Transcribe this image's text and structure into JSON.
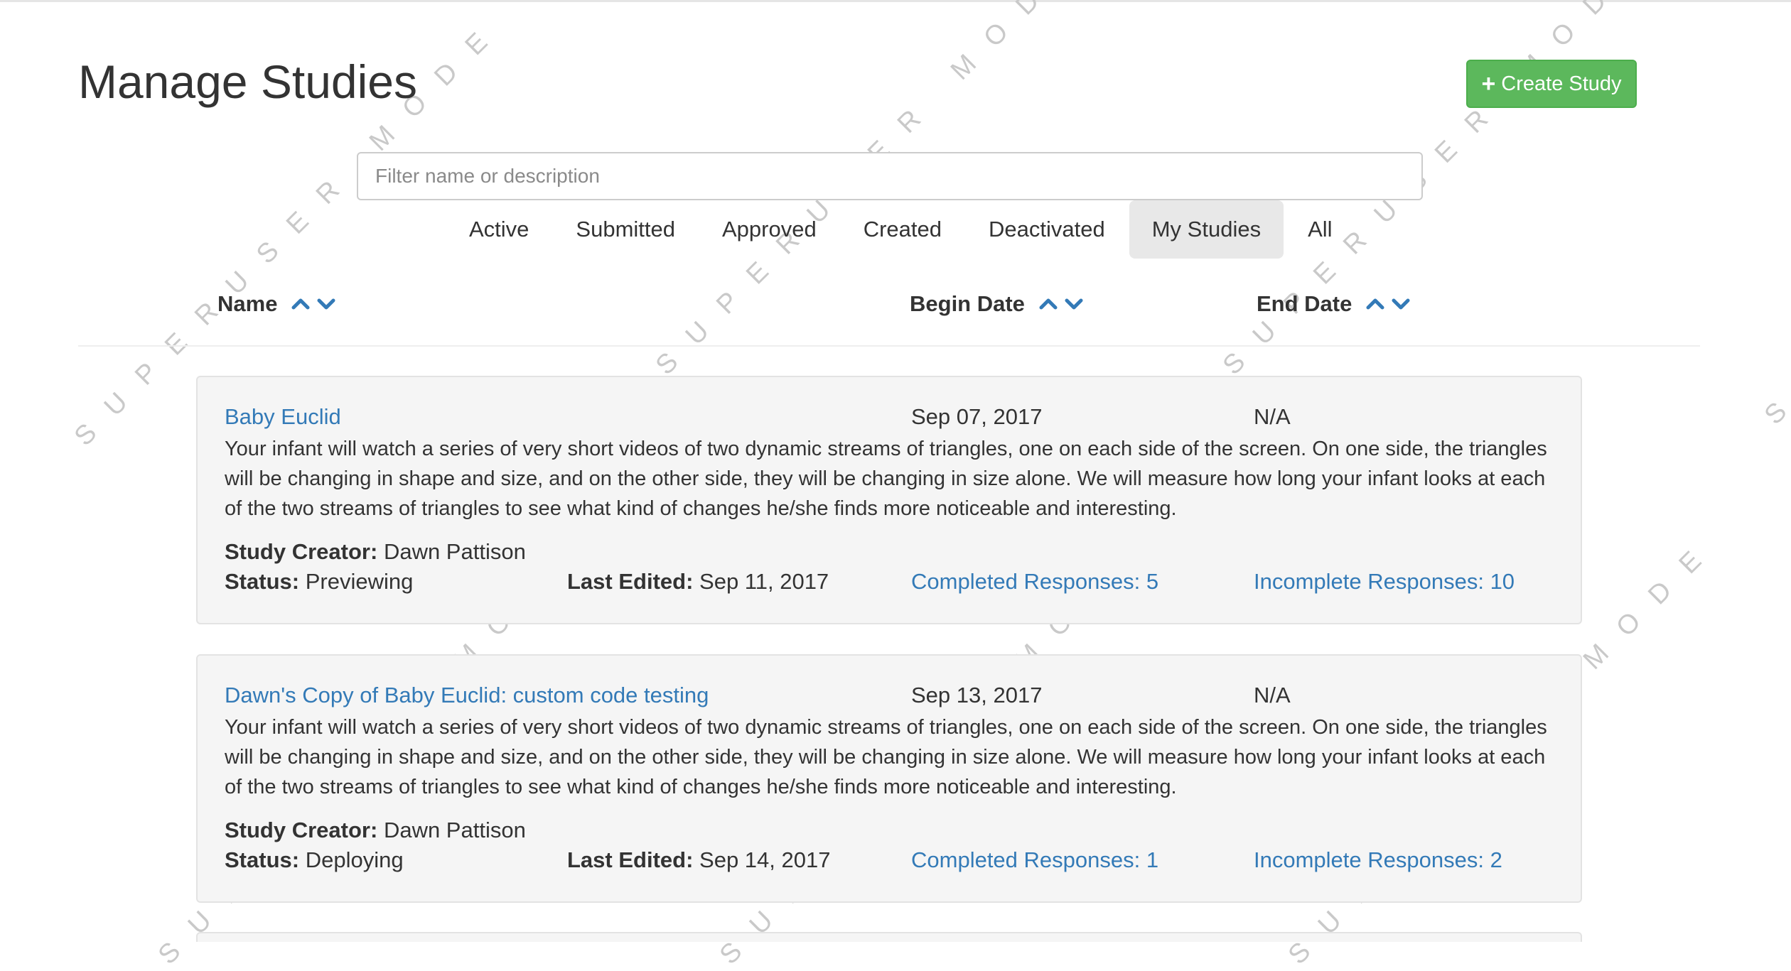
{
  "watermark": "SUPERUSER MODE",
  "page": {
    "title": "Manage Studies",
    "create_button_label": "Create Study",
    "create_icon": "plus-icon",
    "filter_placeholder": "Filter name or description",
    "filter_value": ""
  },
  "tabs": {
    "items": [
      {
        "label": "Active",
        "active": false
      },
      {
        "label": "Submitted",
        "active": false
      },
      {
        "label": "Approved",
        "active": false
      },
      {
        "label": "Created",
        "active": false
      },
      {
        "label": "Deactivated",
        "active": false
      },
      {
        "label": "My Studies",
        "active": true
      },
      {
        "label": "All",
        "active": false
      }
    ]
  },
  "columns": {
    "name": "Name",
    "begin_date": "Begin Date",
    "end_date": "End Date",
    "sort_icons": [
      "chevron-up-icon",
      "chevron-down-icon"
    ]
  },
  "colors": {
    "link": "#337ab7",
    "create_button": "#5cb85c",
    "active_tab": "#e8e8e8",
    "card_background": "#f5f5f5"
  },
  "studies": [
    {
      "name": "Baby Euclid",
      "begin_date": "Sep 07, 2017",
      "end_date": "N/A",
      "description": "Your infant will watch a series of very short videos of two dynamic streams of triangles, one on each side of the screen. On one side, the triangles will be changing in shape and size, and on the other side, they will be changing in size alone. We will measure how long your infant looks at each of the two streams of triangles to see what kind of changes he/she finds more noticeable and interesting.",
      "creator_label": "Study Creator:",
      "creator": "Dawn Pattison",
      "status_label": "Status:",
      "status": "Previewing",
      "last_edited_label": "Last Edited:",
      "last_edited": "Sep 11, 2017",
      "completed_responses": "Completed Responses: 5",
      "incomplete_responses": "Incomplete Responses: 10"
    },
    {
      "name": "Dawn's Copy of Baby Euclid: custom code testing",
      "begin_date": "Sep 13, 2017",
      "end_date": "N/A",
      "description": "Your infant will watch a series of very short videos of two dynamic streams of triangles, one on each side of the screen. On one side, the triangles will be changing in shape and size, and on the other side, they will be changing in size alone. We will measure how long your infant looks at each of the two streams of triangles to see what kind of changes he/she finds more noticeable and interesting.",
      "creator_label": "Study Creator:",
      "creator": "Dawn Pattison",
      "status_label": "Status:",
      "status": "Deploying",
      "last_edited_label": "Last Edited:",
      "last_edited": "Sep 14, 2017",
      "completed_responses": "Completed Responses: 1",
      "incomplete_responses": "Incomplete Responses: 2"
    }
  ]
}
